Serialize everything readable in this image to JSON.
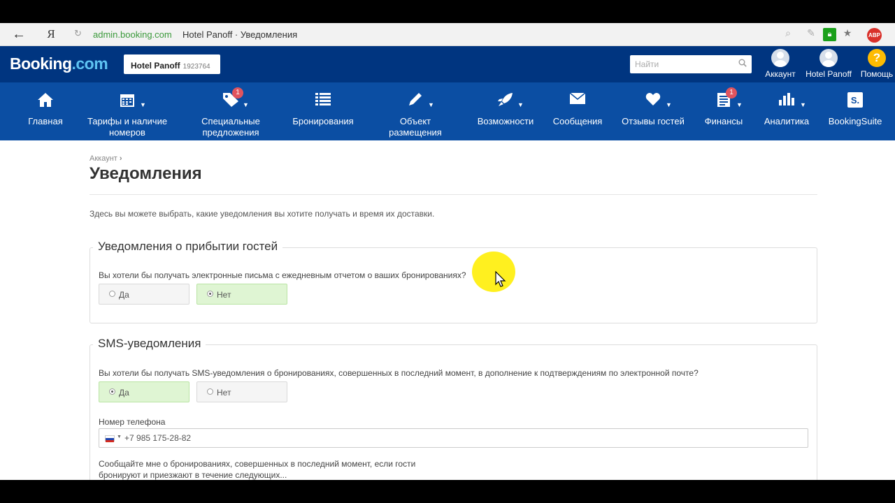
{
  "browser": {
    "back_glyph": "←",
    "yandex_glyph": "Я",
    "url_domain": "admin.booking.com",
    "url_title": "Hotel Panoff · Уведомления",
    "abp_label": "ABP"
  },
  "header": {
    "logo_main": "Booking",
    "logo_suffix": ".com",
    "hotel_name": "Hotel Panoff",
    "hotel_id": "1923764",
    "search_placeholder": "Найти",
    "account_label": "Аккаунт",
    "hotel_label": "Hotel Panoff",
    "help_label": "Помощь",
    "help_glyph": "?"
  },
  "nav": {
    "items": [
      {
        "label": "Главная",
        "icon": "home-icon"
      },
      {
        "label": "Тарифы и наличие номеров",
        "icon": "calendar-icon"
      },
      {
        "label": "Специальные предложения",
        "icon": "tag-icon",
        "badge": "1"
      },
      {
        "label": "Бронирования",
        "icon": "list-icon"
      },
      {
        "label": "Объект размещения",
        "icon": "pencil-icon"
      },
      {
        "label": "Возможности",
        "icon": "rocket-icon"
      },
      {
        "label": "Сообщения",
        "icon": "envelope-icon"
      },
      {
        "label": "Отзывы гостей",
        "icon": "heart-icon"
      },
      {
        "label": "Финансы",
        "icon": "invoice-icon",
        "badge": "1"
      },
      {
        "label": "Аналитика",
        "icon": "bar-chart-icon"
      },
      {
        "label": "BookingSuite",
        "icon": "bookingsuite-icon",
        "icon_text": "S."
      }
    ]
  },
  "page": {
    "breadcrumb": "Аккаунт",
    "title": "Уведомления",
    "intro": "Здесь вы можете выбрать, какие уведомления вы хотите получать и время их доставки."
  },
  "arrival_section": {
    "legend": "Уведомления о прибытии гостей",
    "question": "Вы хотели бы получать электронные письма с ежедневным отчетом о ваших бронированиях?",
    "yes_label": "Да",
    "no_label": "Нет",
    "selected": "Нет"
  },
  "sms_section": {
    "legend": "SMS-уведомления",
    "question": "Вы хотели бы получать SMS-уведомления о бронированиях, совершенных в последний момент, в дополнение к подтверждениям по электронной почте?",
    "yes_label": "Да",
    "no_label": "Нет",
    "selected": "Да",
    "phone_label": "Номер телефона",
    "phone_value": "+7 985 175-28-82",
    "lastmin_line1": "Сообщайте мне о бронированиях, совершенных в последний момент, если гости",
    "lastmin_line2": "бронируют и приезжают в течение следующих..."
  },
  "colors": {
    "brand_dark": "#003580",
    "brand_nav": "#0b4ea3",
    "selected_bg": "#dff5d3",
    "badge": "#e0545e"
  }
}
